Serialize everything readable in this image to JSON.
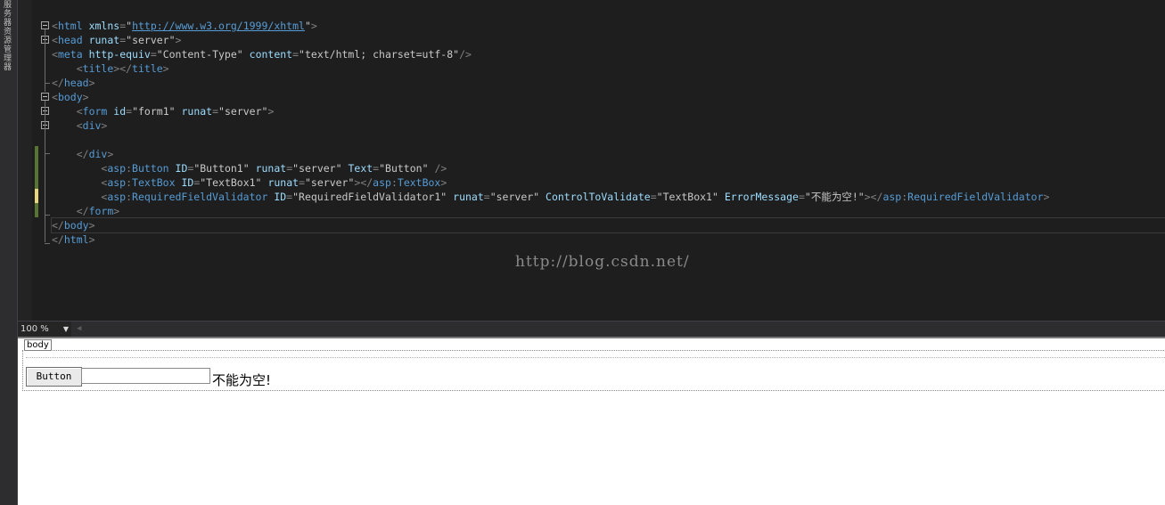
{
  "side_panel": {
    "label": "服务器资源管理器"
  },
  "editor": {
    "lines": [
      [
        {
          "c": "t",
          "s": "<"
        },
        {
          "c": "tag",
          "s": "html"
        },
        {
          "c": "txt",
          "s": " "
        },
        {
          "c": "attr",
          "s": "xmlns"
        },
        {
          "c": "t",
          "s": "="
        },
        {
          "c": "val",
          "s": "\""
        },
        {
          "c": "link",
          "s": "http://www.w3.org/1999/xhtml"
        },
        {
          "c": "val",
          "s": "\""
        },
        {
          "c": "t",
          "s": ">"
        }
      ],
      [
        {
          "c": "t",
          "s": "<"
        },
        {
          "c": "tag",
          "s": "head"
        },
        {
          "c": "txt",
          "s": " "
        },
        {
          "c": "attr",
          "s": "runat"
        },
        {
          "c": "t",
          "s": "="
        },
        {
          "c": "val",
          "s": "\"server\""
        },
        {
          "c": "t",
          "s": ">"
        }
      ],
      [
        {
          "c": "t",
          "s": "<"
        },
        {
          "c": "tag",
          "s": "meta"
        },
        {
          "c": "txt",
          "s": " "
        },
        {
          "c": "attr",
          "s": "http-equiv"
        },
        {
          "c": "t",
          "s": "="
        },
        {
          "c": "val",
          "s": "\"Content-Type\""
        },
        {
          "c": "txt",
          "s": " "
        },
        {
          "c": "attr",
          "s": "content"
        },
        {
          "c": "t",
          "s": "="
        },
        {
          "c": "val",
          "s": "\"text/html; charset=utf-8\""
        },
        {
          "c": "t",
          "s": "/>"
        }
      ],
      [
        {
          "c": "txt",
          "s": "    "
        },
        {
          "c": "t",
          "s": "<"
        },
        {
          "c": "tag",
          "s": "title"
        },
        {
          "c": "t",
          "s": "></"
        },
        {
          "c": "tag",
          "s": "title"
        },
        {
          "c": "t",
          "s": ">"
        }
      ],
      [
        {
          "c": "t",
          "s": "</"
        },
        {
          "c": "tag",
          "s": "head"
        },
        {
          "c": "t",
          "s": ">"
        }
      ],
      [
        {
          "c": "t",
          "s": "<"
        },
        {
          "c": "tag",
          "s": "body"
        },
        {
          "c": "t",
          "s": ">"
        }
      ],
      [
        {
          "c": "txt",
          "s": "    "
        },
        {
          "c": "t",
          "s": "<"
        },
        {
          "c": "tag",
          "s": "form"
        },
        {
          "c": "txt",
          "s": " "
        },
        {
          "c": "attr",
          "s": "id"
        },
        {
          "c": "t",
          "s": "="
        },
        {
          "c": "val",
          "s": "\"form1\""
        },
        {
          "c": "txt",
          "s": " "
        },
        {
          "c": "attr",
          "s": "runat"
        },
        {
          "c": "t",
          "s": "="
        },
        {
          "c": "val",
          "s": "\"server\""
        },
        {
          "c": "t",
          "s": ">"
        }
      ],
      [
        {
          "c": "txt",
          "s": "    "
        },
        {
          "c": "t",
          "s": "<"
        },
        {
          "c": "tag",
          "s": "div"
        },
        {
          "c": "t",
          "s": ">"
        }
      ],
      [],
      [
        {
          "c": "txt",
          "s": "    "
        },
        {
          "c": "t",
          "s": "</"
        },
        {
          "c": "tag",
          "s": "div"
        },
        {
          "c": "t",
          "s": ">"
        }
      ],
      [
        {
          "c": "txt",
          "s": "        "
        },
        {
          "c": "t",
          "s": "<"
        },
        {
          "c": "tag",
          "s": "asp"
        },
        {
          "c": "t",
          "s": ":"
        },
        {
          "c": "tag",
          "s": "Button"
        },
        {
          "c": "txt",
          "s": " "
        },
        {
          "c": "attr",
          "s": "ID"
        },
        {
          "c": "t",
          "s": "="
        },
        {
          "c": "val",
          "s": "\"Button1\""
        },
        {
          "c": "txt",
          "s": " "
        },
        {
          "c": "attr",
          "s": "runat"
        },
        {
          "c": "t",
          "s": "="
        },
        {
          "c": "val",
          "s": "\"server\""
        },
        {
          "c": "txt",
          "s": " "
        },
        {
          "c": "attr",
          "s": "Text"
        },
        {
          "c": "t",
          "s": "="
        },
        {
          "c": "val",
          "s": "\"Button\""
        },
        {
          "c": "txt",
          "s": " "
        },
        {
          "c": "t",
          "s": "/>"
        }
      ],
      [
        {
          "c": "txt",
          "s": "        "
        },
        {
          "c": "t",
          "s": "<"
        },
        {
          "c": "tag",
          "s": "asp"
        },
        {
          "c": "t",
          "s": ":"
        },
        {
          "c": "tag",
          "s": "TextBox"
        },
        {
          "c": "txt",
          "s": " "
        },
        {
          "c": "attr",
          "s": "ID"
        },
        {
          "c": "t",
          "s": "="
        },
        {
          "c": "val",
          "s": "\"TextBox1\""
        },
        {
          "c": "txt",
          "s": " "
        },
        {
          "c": "attr",
          "s": "runat"
        },
        {
          "c": "t",
          "s": "="
        },
        {
          "c": "val",
          "s": "\"server\""
        },
        {
          "c": "t",
          "s": "></"
        },
        {
          "c": "tag",
          "s": "asp"
        },
        {
          "c": "t",
          "s": ":"
        },
        {
          "c": "tag",
          "s": "TextBox"
        },
        {
          "c": "t",
          "s": ">"
        }
      ],
      [
        {
          "c": "txt",
          "s": "        "
        },
        {
          "c": "t",
          "s": "<"
        },
        {
          "c": "tag",
          "s": "asp"
        },
        {
          "c": "t",
          "s": ":"
        },
        {
          "c": "tag",
          "s": "RequiredFieldValidator"
        },
        {
          "c": "txt",
          "s": " "
        },
        {
          "c": "attr",
          "s": "ID"
        },
        {
          "c": "t",
          "s": "="
        },
        {
          "c": "val",
          "s": "\"RequiredFieldValidator1\""
        },
        {
          "c": "txt",
          "s": " "
        },
        {
          "c": "attr",
          "s": "runat"
        },
        {
          "c": "t",
          "s": "="
        },
        {
          "c": "val",
          "s": "\"server\""
        },
        {
          "c": "txt",
          "s": " "
        },
        {
          "c": "attr",
          "s": "ControlToValidate"
        },
        {
          "c": "t",
          "s": "="
        },
        {
          "c": "val",
          "s": "\"TextBox1\""
        },
        {
          "c": "txt",
          "s": " "
        },
        {
          "c": "attr",
          "s": "ErrorMessage"
        },
        {
          "c": "t",
          "s": "="
        },
        {
          "c": "val",
          "s": "\"不能为空!\""
        },
        {
          "c": "t",
          "s": "></"
        },
        {
          "c": "tag",
          "s": "asp"
        },
        {
          "c": "t",
          "s": ":"
        },
        {
          "c": "tag",
          "s": "RequiredFieldValidator"
        },
        {
          "c": "t",
          "s": ">"
        }
      ],
      [
        {
          "c": "txt",
          "s": "    "
        },
        {
          "c": "t",
          "s": "</"
        },
        {
          "c": "tag",
          "s": "form"
        },
        {
          "c": "t",
          "s": ">"
        }
      ],
      [
        {
          "c": "t",
          "s": "</"
        },
        {
          "c": "tag",
          "s": "body"
        },
        {
          "c": "t",
          "s": ">"
        }
      ],
      [
        {
          "c": "t",
          "s": "</"
        },
        {
          "c": "tag",
          "s": "html"
        },
        {
          "c": "t",
          "s": ">"
        }
      ]
    ]
  },
  "watermark": "http://blog.csdn.net/",
  "statusbar": {
    "zoom": "100 %"
  },
  "design": {
    "body_tag": "body",
    "button_label": "Button",
    "textbox_value": "",
    "validator_message": "不能为空!"
  }
}
